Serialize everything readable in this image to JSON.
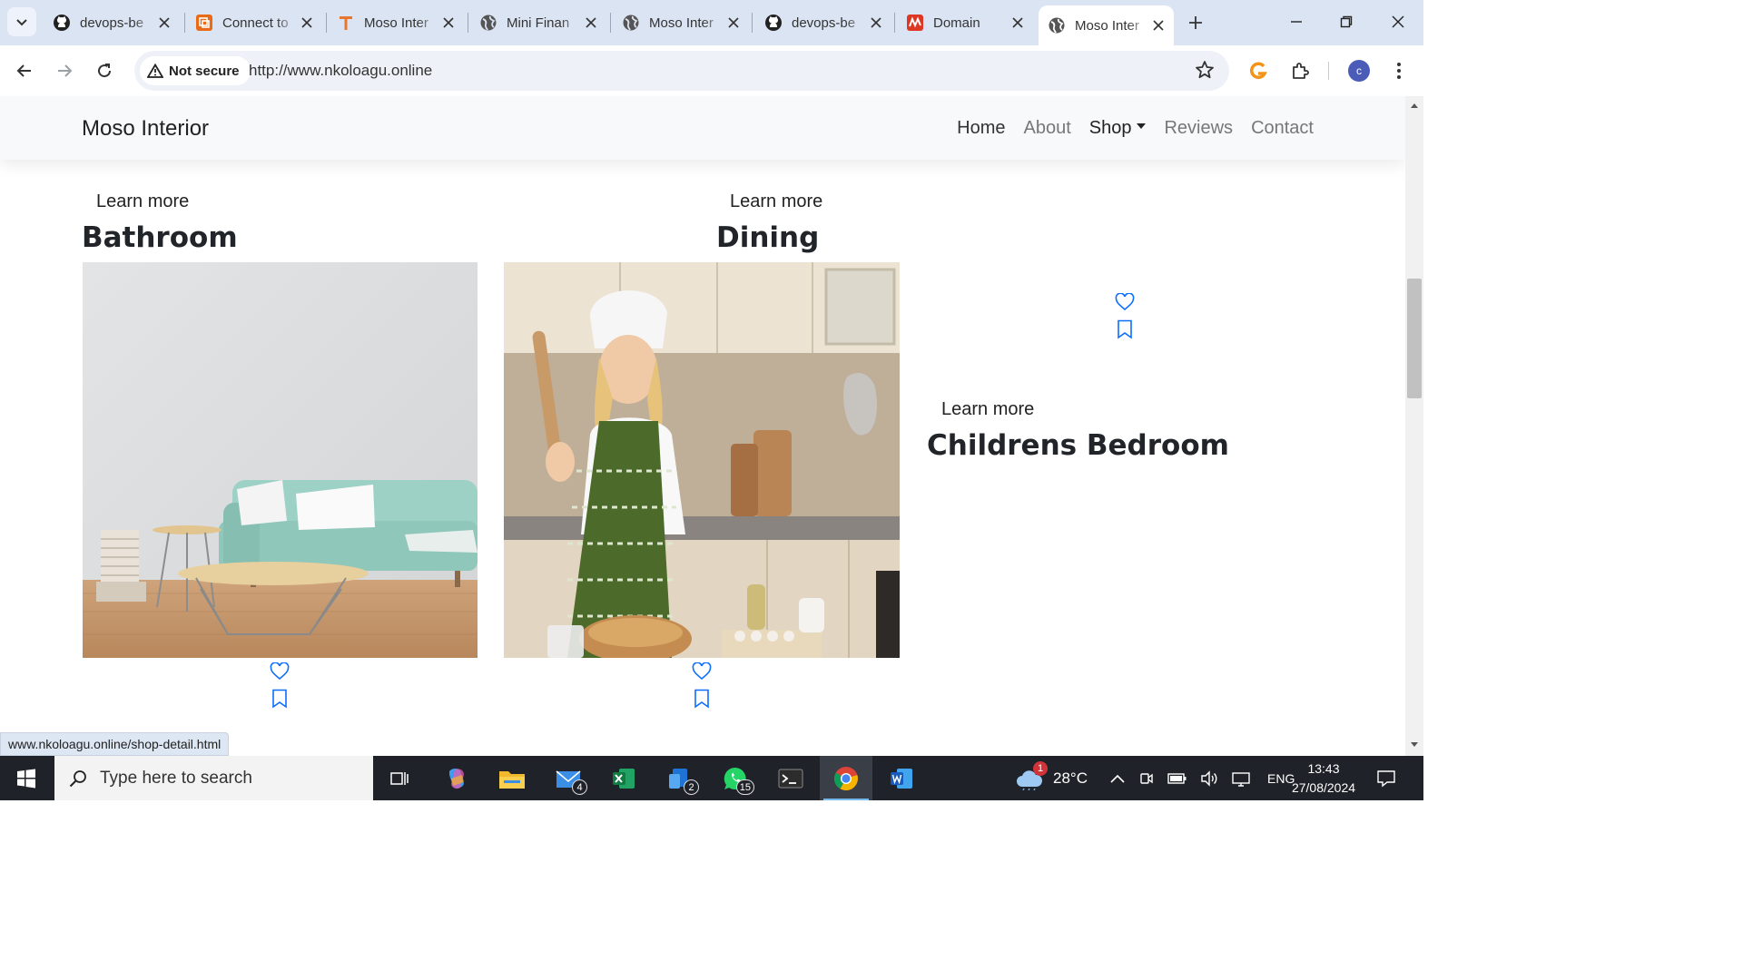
{
  "browser": {
    "tabs": [
      {
        "title": "devops-be",
        "icon": "github-icon"
      },
      {
        "title": "Connect to",
        "icon": "aws-icon"
      },
      {
        "title": "Moso Inter",
        "icon": "t-icon"
      },
      {
        "title": "Mini Finan",
        "icon": "globe-icon"
      },
      {
        "title": "Moso Inter",
        "icon": "globe-icon"
      },
      {
        "title": "devops-be",
        "icon": "github-icon"
      },
      {
        "title": "Domain",
        "icon": "namecheap-icon"
      },
      {
        "title": "Moso Inter",
        "icon": "globe-icon",
        "active": true
      }
    ],
    "security_label": "Not secure",
    "url": "http://www.nkoloagu.online",
    "profile_initial": "c",
    "status_url": "www.nkoloagu.online/shop-detail.html"
  },
  "site": {
    "brand": "Moso Interior",
    "nav": [
      "Home",
      "About",
      "Shop",
      "Reviews",
      "Contact"
    ]
  },
  "cards": [
    {
      "learn": "Learn more",
      "title": "Bathroom"
    },
    {
      "learn": "Learn more",
      "title": "Dining"
    },
    {
      "learn": "Learn more",
      "title": "Childrens Bedroom"
    }
  ],
  "taskbar": {
    "search_placeholder": "Type here to search",
    "mail_badge": "4",
    "teams_badge": "2",
    "whatsapp_badge": "15",
    "weather_badge": "1",
    "temperature": "28°C",
    "language": "ENG",
    "time": "13:43",
    "date": "27/08/2024"
  },
  "colors": {
    "accent_link": "#0d6efd",
    "tabbar": "#dbe4f3"
  }
}
